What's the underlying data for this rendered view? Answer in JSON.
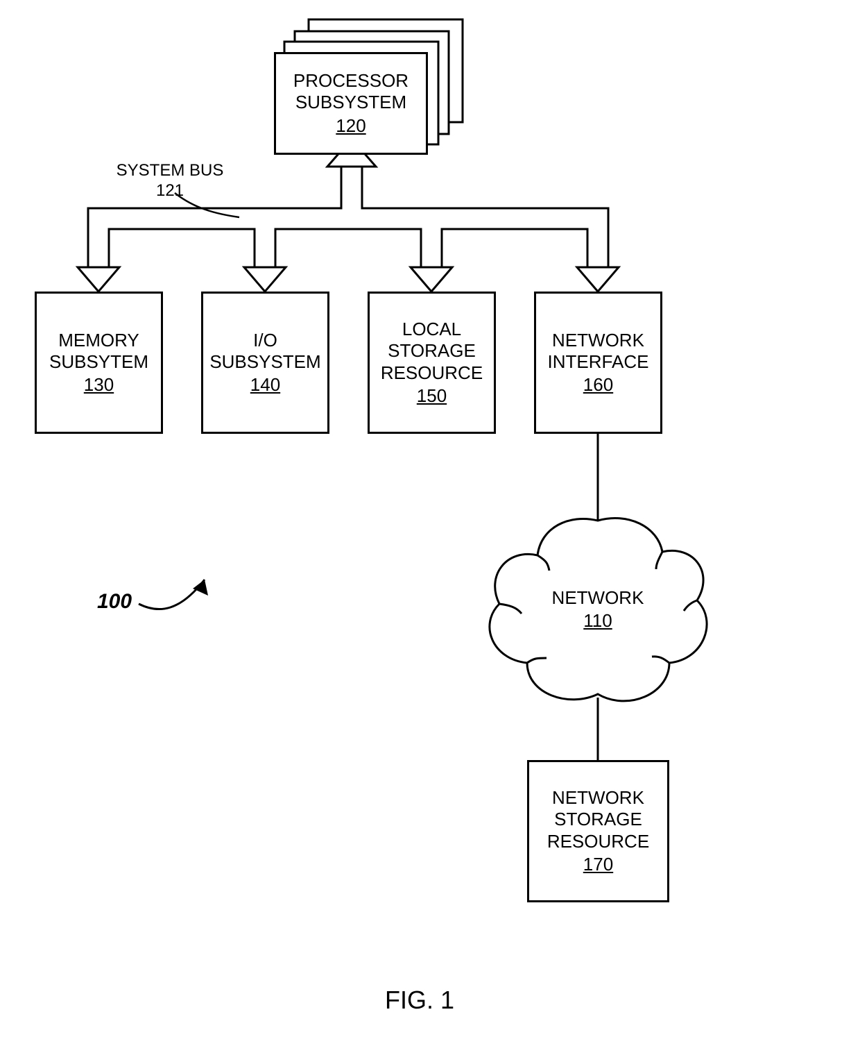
{
  "figure": {
    "pointer_ref": "100",
    "caption": "FIG. 1"
  },
  "bus": {
    "label": "SYSTEM BUS",
    "ref": "121"
  },
  "blocks": {
    "processor": {
      "title": "PROCESSOR SUBSYSTEM",
      "ref": "120"
    },
    "memory": {
      "title": "MEMORY SUBSYTEM",
      "ref": "130"
    },
    "io": {
      "title": "I/O SUBSYSTEM",
      "ref": "140"
    },
    "storage": {
      "title": "LOCAL STORAGE RESOURCE",
      "ref": "150"
    },
    "netif": {
      "title": "NETWORK INTERFACE",
      "ref": "160"
    },
    "network": {
      "title": "NETWORK",
      "ref": "110"
    },
    "netstor": {
      "title": "NETWORK STORAGE RESOURCE",
      "ref": "170"
    }
  }
}
